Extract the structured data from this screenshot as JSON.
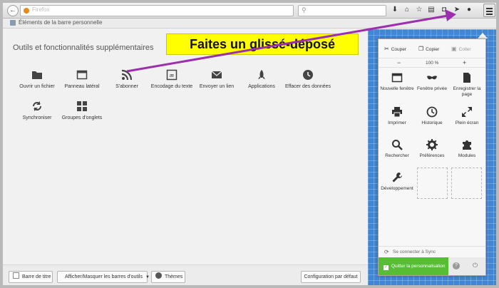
{
  "toolbar": {
    "url_text": "Firefox",
    "reload_icon": "↻",
    "back_icon": "←",
    "search_icon": "⚲"
  },
  "bookmarks_bar": {
    "label": "Éléments de la barre personnelle"
  },
  "palette": {
    "title": "Outils et fonctionnalités supplémentaires",
    "items": [
      {
        "label": "Ouvrir un fichier",
        "icon": "folder-icon"
      },
      {
        "label": "Panneau latéral",
        "icon": "sidebar-icon"
      },
      {
        "label": "S'abonner",
        "icon": "rss-icon"
      },
      {
        "label": "Encodage du texte",
        "icon": "text-encoding-icon"
      },
      {
        "label": "Envoyer un lien",
        "icon": "envelope-icon"
      },
      {
        "label": "Applications",
        "icon": "rocket-icon"
      },
      {
        "label": "Effacer des données",
        "icon": "forget-icon"
      },
      {
        "label": "Synchroniser",
        "icon": "sync-icon"
      },
      {
        "label": "Groupes d'onglets",
        "icon": "tab-groups-icon"
      }
    ]
  },
  "banner": {
    "text": "Faites un glissé-déposé"
  },
  "bottom_bar": {
    "title_bar_label": "Barre de titre",
    "toolbars_label": "Afficher/Masquer les barres d'outils",
    "themes_label": "Thèmes",
    "restore_label": "Configuration par défaut"
  },
  "menu_panel": {
    "cut_label": "Couper",
    "copy_label": "Copier",
    "paste_label": "Coller",
    "zoom_out": "−",
    "zoom_value": "100 %",
    "zoom_in": "+",
    "items": [
      {
        "label": "Nouvelle fenêtre",
        "icon": "new-window-icon"
      },
      {
        "label": "Fenêtre privée",
        "icon": "private-mask-icon"
      },
      {
        "label": "Enregistrer la page",
        "icon": "save-page-icon"
      },
      {
        "label": "Imprimer",
        "icon": "print-icon"
      },
      {
        "label": "Historique",
        "icon": "history-clock-icon"
      },
      {
        "label": "Plein écran",
        "icon": "fullscreen-icon"
      },
      {
        "label": "Rechercher",
        "icon": "find-magnifier-icon"
      },
      {
        "label": "Préférences",
        "icon": "gear-icon"
      },
      {
        "label": "Modules",
        "icon": "puzzle-icon"
      },
      {
        "label": "Développement",
        "icon": "wrench-icon"
      }
    ],
    "sync_label": "Se connecter à Sync",
    "quit_label": "Quitter la personnalisation",
    "help_icon": "?",
    "power_icon": "⏻"
  },
  "colors": {
    "banner": "#ffff00",
    "arrow": "#9b2fae",
    "blueprint": "#3f86d6",
    "quit_green": "#57bd35"
  }
}
